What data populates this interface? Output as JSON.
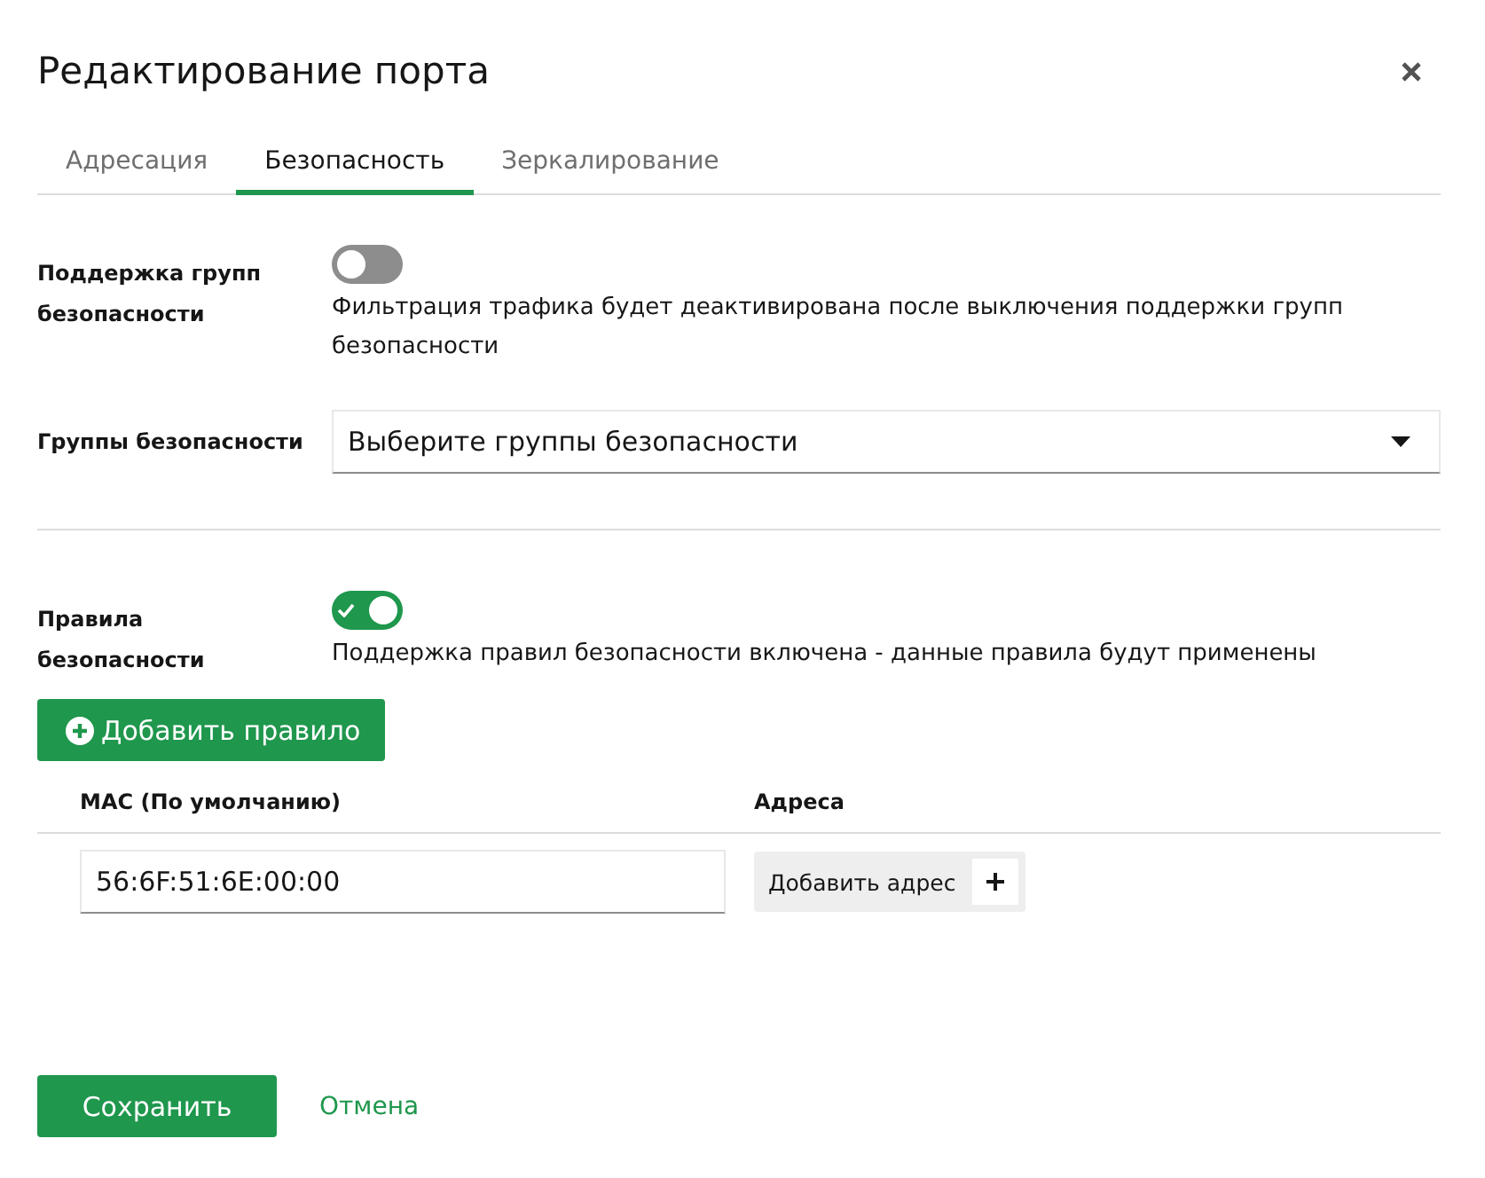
{
  "dialog": {
    "title": "Редактирование порта"
  },
  "tabs": [
    {
      "label": "Адресация",
      "selected": false
    },
    {
      "label": "Безопасность",
      "selected": true
    },
    {
      "label": "Зеркалирование",
      "selected": false
    }
  ],
  "sections": [
    {
      "fields": [
        {
          "kind": "switch",
          "label": "Поддержка групп безопасности",
          "on": false,
          "description": "Фильтрация трафика будет деактивирована после выключения поддержки групп безопасности"
        },
        {
          "kind": "select",
          "label": "Группы безопасности",
          "placeholder": "Выберите группы безопасности"
        }
      ]
    },
    {
      "fields": [
        {
          "kind": "switch",
          "label": "Правила безопасности",
          "on": true,
          "description": "Поддержка правил безопасности включена - данные правила будут применены"
        }
      ],
      "add_button": "Добавить правило",
      "table": {
        "columns": [
          "MAC (По умолчанию)",
          "Адреса"
        ],
        "rows": [
          {
            "mac": "56:6F:51:6E:00:00",
            "add_address_button": "Добавить адрес"
          }
        ]
      }
    }
  ],
  "footer": {
    "save_button": "Сохранить",
    "cancel_link": "Отмена"
  }
}
